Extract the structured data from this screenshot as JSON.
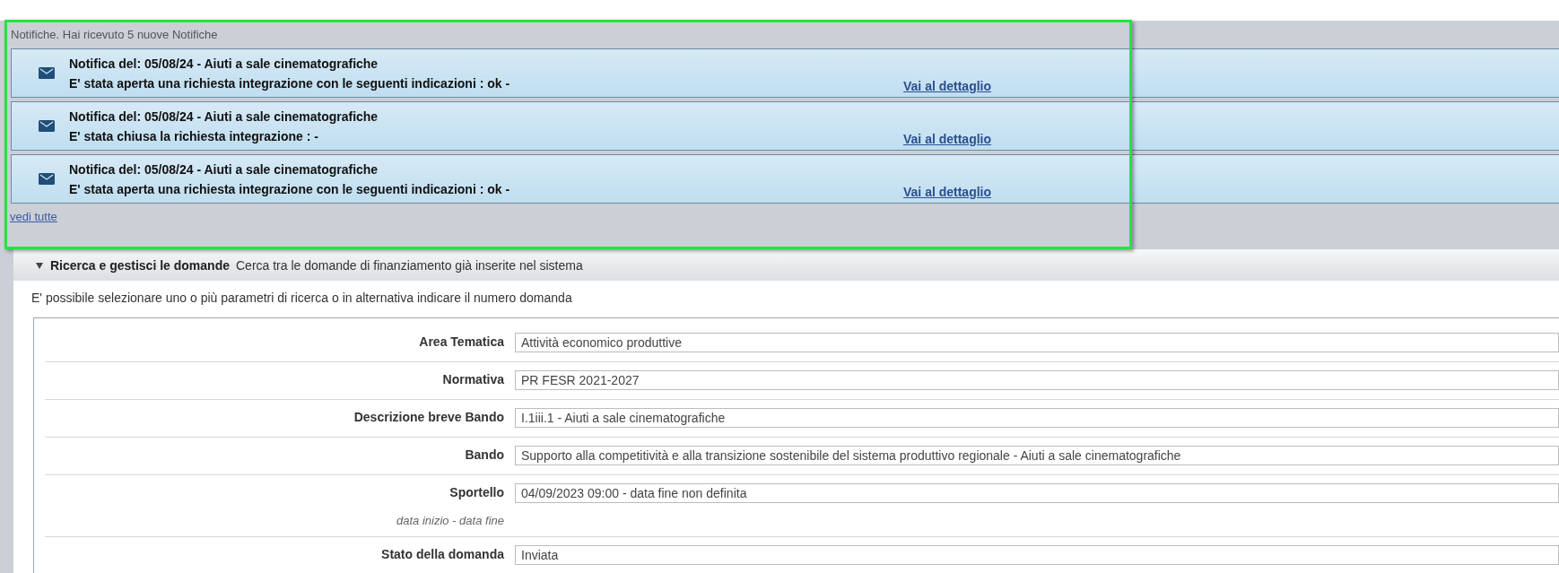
{
  "notifications_panel": {
    "highlighted": true,
    "heading": "Notifiche. Hai ricevuto 5 nuove Notifiche",
    "items": [
      {
        "title": "Notifica del: 05/08/24 - Aiuti a sale cinematografiche",
        "message": "E' stata aperta una richiesta integrazione con le seguenti indicazioni : ok -",
        "link": "Vai al dettaglio"
      },
      {
        "title": "Notifica del: 05/08/24 - Aiuti a sale cinematografiche",
        "message": "E' stata chiusa la richiesta integrazione : -",
        "link": "Vai al dettaglio"
      },
      {
        "title": "Notifica del: 05/08/24 - Aiuti a sale cinematografiche",
        "message": "E' stata aperta una richiesta integrazione con le seguenti indicazioni : ok -",
        "link": "Vai al dettaglio"
      }
    ],
    "see_all": "vedi tutte"
  },
  "search_section": {
    "expanded": true,
    "title": "Ricerca e gestisci le domande",
    "subtitle": "Cerca tra le domande di finanziamento già inserite nel sistema",
    "hint": "E' possibile selezionare uno o più parametri di ricerca o in alternativa indicare il numero domanda",
    "fields": [
      {
        "label": "Area Tematica",
        "value": "Attività economico produttive"
      },
      {
        "label": "Normativa",
        "value": "PR FESR 2021-2027"
      },
      {
        "label": "Descrizione breve Bando",
        "value": "I.1iii.1 - Aiuti a sale cinematografiche"
      },
      {
        "label": "Bando",
        "value": "Supporto alla competitività e alla transizione sostenibile del sistema produttivo regionale - Aiuti a sale cinematografiche"
      },
      {
        "label": "Sportello",
        "sublabel": "data inizio - data fine",
        "value": "04/09/2023 09:00 - data fine non definita"
      },
      {
        "label": "Stato della domanda",
        "value": "Inviata"
      }
    ]
  }
}
